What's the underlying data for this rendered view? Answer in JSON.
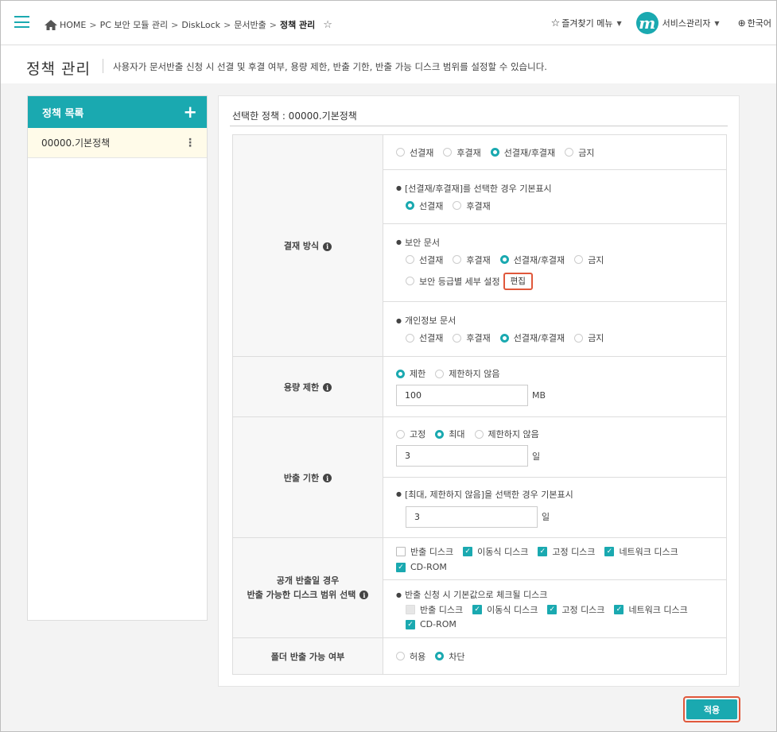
{
  "header": {
    "breadcrumb": [
      "HOME",
      "PC 보안 모듈 관리",
      "DiskLock",
      "문서반출"
    ],
    "current": "정책 관리",
    "favorites": "즐겨찾기 메뉴",
    "user": "서비스관리자",
    "avatar_letter": "m",
    "language": "한국어"
  },
  "page": {
    "title": "정책 관리",
    "description": "사용자가 문서반출 신청 시 선결 및 후결 여부, 용량 제한, 반출 기한, 반출 가능 디스크 범위를 설정할 수 있습니다."
  },
  "policy_list": {
    "title": "정책 목록",
    "items": [
      "00000.기본정책"
    ]
  },
  "policy": {
    "selected_label": "선택한 정책 : 00000.기본정책",
    "approval": {
      "label": "결재 방식",
      "options": [
        "선결재",
        "후결재",
        "선결재/후결재",
        "금지"
      ],
      "selected": "선결재/후결재",
      "default_note": "[선결재/후결재]를 선택한 경우 기본표시",
      "default_options": [
        "선결재",
        "후결재"
      ],
      "default_selected": "선결재",
      "security_doc": "보안 문서",
      "security_options": [
        "선결재",
        "후결재",
        "선결재/후결재",
        "금지"
      ],
      "security_selected": "선결재/후결재",
      "security_grade": "보안 등급별 세부 설정",
      "edit": "편집",
      "privacy_doc": "개인정보 문서",
      "privacy_options": [
        "선결재",
        "후결재",
        "선결재/후결재",
        "금지"
      ],
      "privacy_selected": "선결재/후결재"
    },
    "capacity": {
      "label": "용량 제한",
      "options": [
        "제한",
        "제한하지 않음"
      ],
      "selected": "제한",
      "value": "100",
      "unit": "MB"
    },
    "deadline": {
      "label": "반출 기한",
      "options": [
        "고정",
        "최대",
        "제한하지 않음"
      ],
      "selected": "최대",
      "value": "3",
      "unit": "일",
      "default_note": "[최대, 제한하지 않음]을 선택한 경우 기본표시",
      "default_value": "3",
      "default_unit": "일"
    },
    "disk": {
      "label_line1": "공개 반출일 경우",
      "label_line2": "반출 가능한 디스크 범위 선택",
      "options": [
        "반출 디스크",
        "이동식 디스크",
        "고정 디스크",
        "네트워크 디스크",
        "CD-ROM"
      ],
      "checked": [
        false,
        true,
        true,
        true,
        true
      ],
      "default_note": "반출 신청 시 기본값으로 체크될 디스크",
      "default_checked": [
        false,
        true,
        true,
        true,
        true
      ]
    },
    "folder": {
      "label": "폴더 반출 가능 여부",
      "options": [
        "허용",
        "차단"
      ],
      "selected": "차단"
    }
  },
  "apply_label": "적용",
  "colors": {
    "accent": "#1aa9b0",
    "highlight": "#e0583b"
  }
}
